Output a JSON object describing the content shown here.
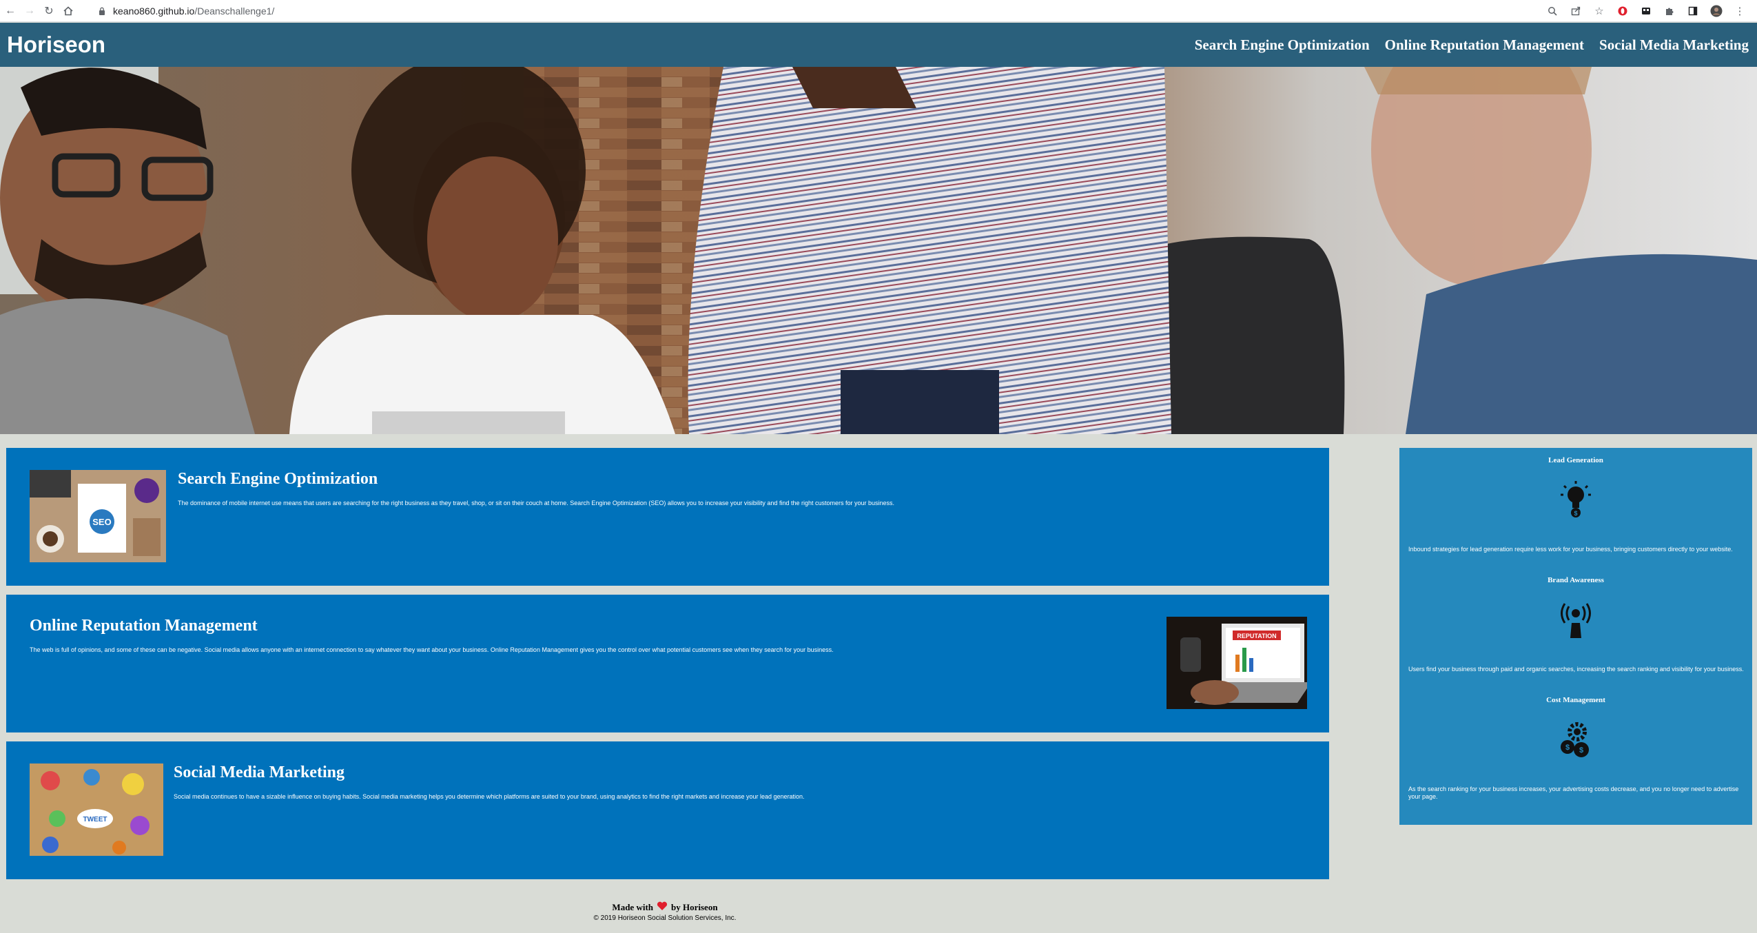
{
  "browser": {
    "url_host": "keano860.github.io",
    "url_path": "/Deanschallenge1/"
  },
  "header": {
    "logo": "Horiseon",
    "nav": [
      "Search Engine Optimization",
      "Online Reputation Management",
      "Social Media Marketing"
    ]
  },
  "cards": [
    {
      "title": "Search Engine Optimization",
      "text": "The dominance of mobile internet use means that users are searching for the right business as they travel, shop, or sit on their couch at home. Search Engine Optimization (SEO) allows you to increase your visibility and find the right customers for your business.",
      "image_label": "SEO"
    },
    {
      "title": "Online Reputation Management",
      "text": "The web is full of opinions, and some of these can be negative. Social media allows anyone with an internet connection to say whatever they want about your business. Online Reputation Management gives you the control over what potential customers see when they search for your business.",
      "image_label": "REPUTATION"
    },
    {
      "title": "Social Media Marketing",
      "text": "Social media continues to have a sizable influence on buying habits. Social media marketing helps you determine which platforms are suited to your brand, using analytics to find the right markets and increase your lead generation.",
      "image_label": "TWEET"
    }
  ],
  "benefits": [
    {
      "title": "Lead Generation",
      "icon": "lightbulb-money-icon",
      "text": "Inbound strategies for lead generation require less work for your business, bringing customers directly to your website."
    },
    {
      "title": "Brand Awareness",
      "icon": "broadcast-person-icon",
      "text": "Users find your business through paid and organic searches, increasing the search ranking and visibility for your business."
    },
    {
      "title": "Cost Management",
      "icon": "gears-coins-icon",
      "text": "As the search ranking for your business increases, your advertising costs decrease, and you no longer need to advertise your page."
    }
  ],
  "footer": {
    "made_pre": "Made with",
    "made_post": "by Horiseon",
    "copyright": "© 2019 Horiseon Social Solution Services, Inc."
  },
  "colors": {
    "header_bg": "#2a607c",
    "card_bg": "#0072bb",
    "sidebar_bg": "#2589bd",
    "page_bg": "#d9dcd6",
    "heart": "#e0202e"
  }
}
